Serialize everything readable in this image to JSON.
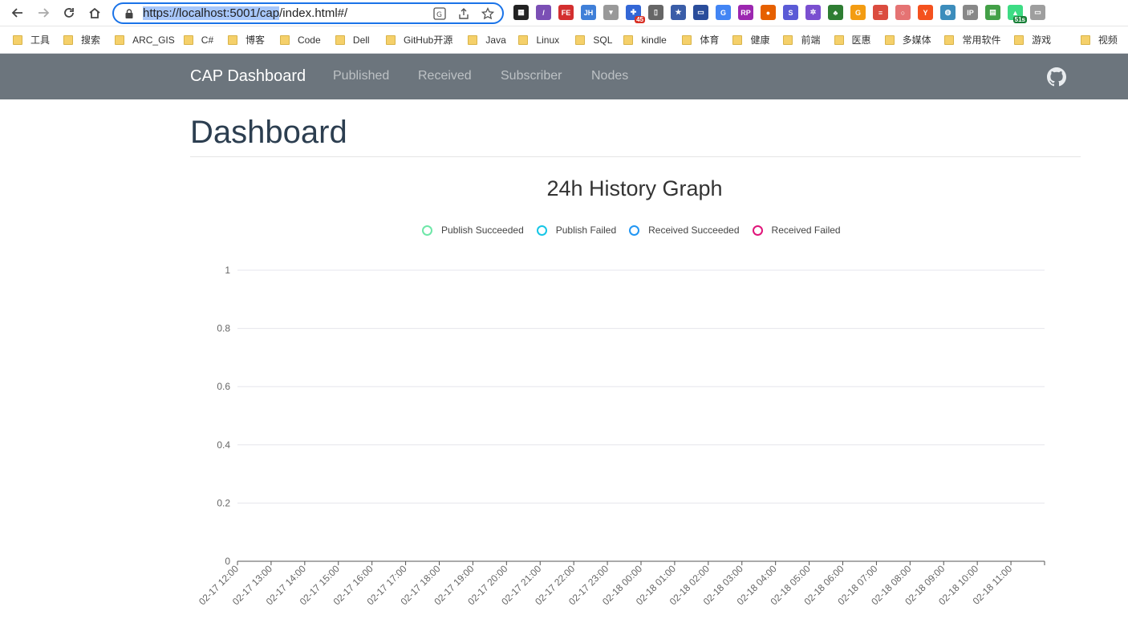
{
  "browser": {
    "url_selected": "https://localhost:5001/cap",
    "url_rest": "/index.html#/",
    "bookmarks": [
      "工具",
      "搜索",
      "ARC_GIS",
      "C#",
      "博客",
      "Code",
      "Dell",
      "GitHub开源",
      "Java",
      "Linux",
      "SQL",
      "kindle",
      "体育",
      "健康",
      "前端",
      "医惠",
      "多媒体",
      "常用软件",
      "游戏",
      "视频"
    ],
    "extensions": [
      {
        "name": "qr-code",
        "label": "▦",
        "color": "#222"
      },
      {
        "name": "feather",
        "label": "/",
        "color": "#7b4fb5"
      },
      {
        "name": "fe",
        "label": "FE",
        "color": "#d32f2f"
      },
      {
        "name": "jh",
        "label": "JH",
        "color": "#3f7fd8"
      },
      {
        "name": "dropdown",
        "label": "▾",
        "color": "#999"
      },
      {
        "name": "puzzle",
        "label": "✚",
        "color": "#3367d6",
        "badge": "45"
      },
      {
        "name": "bookmark",
        "label": "▯",
        "color": "#666"
      },
      {
        "name": "star",
        "label": "★",
        "color": "#3a5da8"
      },
      {
        "name": "window",
        "label": "▭",
        "color": "#2a4d9b"
      },
      {
        "name": "translate",
        "label": "G",
        "color": "#4285f4"
      },
      {
        "name": "rp",
        "label": "RP",
        "color": "#9c27b0"
      },
      {
        "name": "firefox",
        "label": "●",
        "color": "#e66000"
      },
      {
        "name": "s-logo",
        "label": "S",
        "color": "#5b5bd6"
      },
      {
        "name": "gear",
        "label": "✲",
        "color": "#7a4fd0"
      },
      {
        "name": "leaf",
        "label": "♣",
        "color": "#2e7d32"
      },
      {
        "name": "g-orange",
        "label": "G",
        "color": "#f39c12"
      },
      {
        "name": "todo",
        "label": "≡",
        "color": "#db4c3f"
      },
      {
        "name": "circle",
        "label": "○",
        "color": "#e57373"
      },
      {
        "name": "ya",
        "label": "Y",
        "color": "#f4511e"
      },
      {
        "name": "globe",
        "label": "◍",
        "color": "#3c8dbc"
      },
      {
        "name": "ip",
        "label": "IP",
        "color": "#888"
      },
      {
        "name": "palette",
        "label": "▤",
        "color": "#43a047"
      },
      {
        "name": "android",
        "label": "▲",
        "color": "#3ddc84",
        "badge": "51s"
      },
      {
        "name": "reader",
        "label": "▭",
        "color": "#9e9e9e"
      }
    ]
  },
  "app": {
    "brand": "CAP Dashboard",
    "nav": [
      "Published",
      "Received",
      "Subscriber",
      "Nodes"
    ],
    "page_title": "Dashboard"
  },
  "chart_data": {
    "type": "line",
    "title": "24h History Graph",
    "series": [
      {
        "name": "Publish Succeeded",
        "color": "#6ee7a8",
        "values": [
          0,
          0,
          0,
          0,
          0,
          0,
          0,
          0,
          0,
          0,
          0,
          0,
          0,
          0,
          0,
          0,
          0,
          0,
          0,
          0,
          0,
          0,
          0,
          0
        ]
      },
      {
        "name": "Publish Failed",
        "color": "#16c6e6",
        "values": [
          0,
          0,
          0,
          0,
          0,
          0,
          0,
          0,
          0,
          0,
          0,
          0,
          0,
          0,
          0,
          0,
          0,
          0,
          0,
          0,
          0,
          0,
          0,
          0
        ]
      },
      {
        "name": "Received Succeeded",
        "color": "#2196f3",
        "values": [
          0,
          0,
          0,
          0,
          0,
          0,
          0,
          0,
          0,
          0,
          0,
          0,
          0,
          0,
          0,
          0,
          0,
          0,
          0,
          0,
          0,
          0,
          0,
          0
        ]
      },
      {
        "name": "Received Failed",
        "color": "#e0157a",
        "values": [
          0,
          0,
          0,
          0,
          0,
          0,
          0,
          0,
          0,
          0,
          0,
          0,
          0,
          0,
          0,
          0,
          0,
          0,
          0,
          0,
          0,
          0,
          0,
          0
        ]
      }
    ],
    "categories": [
      "02-17 12:00",
      "02-17 13:00",
      "02-17 14:00",
      "02-17 15:00",
      "02-17 16:00",
      "02-17 17:00",
      "02-17 18:00",
      "02-17 19:00",
      "02-17 20:00",
      "02-17 21:00",
      "02-17 22:00",
      "02-17 23:00",
      "02-18 00:00",
      "02-18 01:00",
      "02-18 02:00",
      "02-18 03:00",
      "02-18 04:00",
      "02-18 05:00",
      "02-18 06:00",
      "02-18 07:00",
      "02-18 08:00",
      "02-18 09:00",
      "02-18 10:00",
      "02-18 11:00"
    ],
    "yticks": [
      "0",
      "0.2",
      "0.4",
      "0.6",
      "0.8",
      "1"
    ],
    "ylim": [
      0,
      1
    ],
    "legend": "top-center",
    "grid": true
  }
}
